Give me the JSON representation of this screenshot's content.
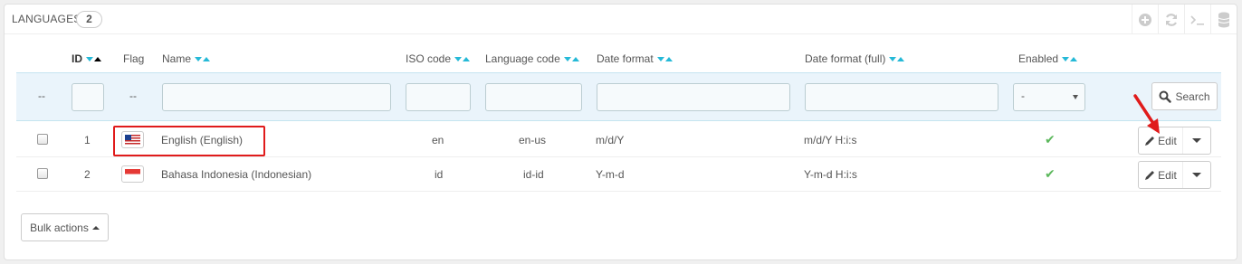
{
  "panel": {
    "title": "LANGUAGES",
    "count": "2",
    "tools": [
      {
        "icon": "add-circle-icon"
      },
      {
        "icon": "refresh-icon"
      },
      {
        "icon": "sql-query-icon"
      },
      {
        "icon": "database-icon"
      }
    ]
  },
  "columns": {
    "id": "ID",
    "flag": "Flag",
    "name": "Name",
    "iso": "ISO code",
    "lang_code": "Language code",
    "date_format": "Date format",
    "date_format_full": "Date format (full)",
    "enabled": "Enabled"
  },
  "filters": {
    "dash": "--",
    "enabled_value": "-",
    "search_label": "Search"
  },
  "rows": [
    {
      "id": "1",
      "name": "English (English)",
      "iso": "en",
      "lang_code": "en-us",
      "date_format": "m/d/Y",
      "date_format_full": "m/d/Y H:i:s",
      "enabled": true,
      "flag": "us-flag-icon",
      "edit_label": "Edit"
    },
    {
      "id": "2",
      "name": "Bahasa Indonesia (Indonesian)",
      "iso": "id",
      "lang_code": "id-id",
      "date_format": "Y-m-d",
      "date_format_full": "Y-m-d H:i:s",
      "enabled": true,
      "flag": "id-flag-icon",
      "edit_label": "Edit"
    }
  ],
  "footer": {
    "bulk_label": "Bulk actions"
  },
  "colors": {
    "accent": "#25b9d7",
    "filter_bg": "#eaf4fb",
    "enabled_check": "#5cb85c",
    "annotation": "#e01b1b"
  }
}
